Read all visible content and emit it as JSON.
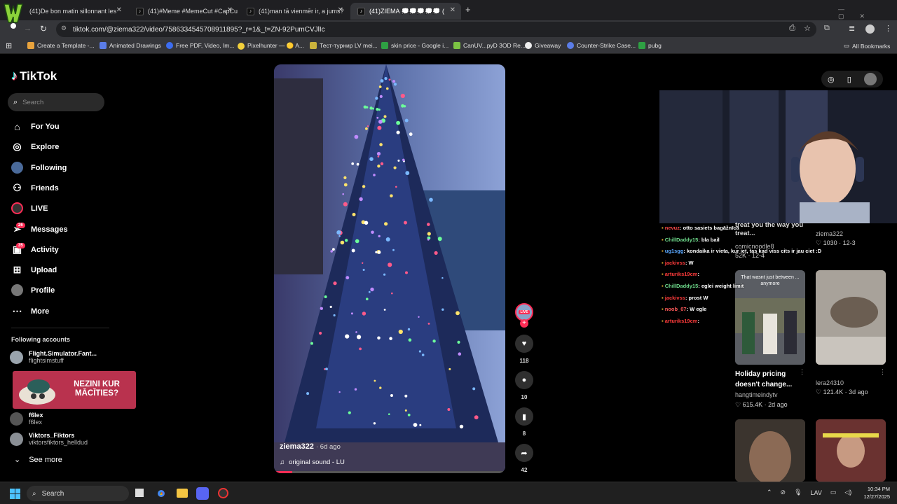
{
  "browser": {
    "tabs": [
      {
        "title": "(41)De bon matin sillonnant les"
      },
      {
        "title": "(41)#Meme #MemeCut #CapCu"
      },
      {
        "title": "(41)man tā vienmēr ir, a jums?"
      },
      {
        "title": "(41)ZIEMA 💭💭💭💭💭 ("
      }
    ],
    "new_tab": "+",
    "url": "tiktok.com/@ziema322/video/7586334545708911895?_r=1&_t=ZN-92PumCVJlIc",
    "bookmarks": [
      {
        "label": "Create a Template -...",
        "color": "#e8a33d"
      },
      {
        "label": "Animated Drawings",
        "color": "#5b7de8"
      },
      {
        "label": "Free PDF, Video, Im...",
        "color": "#3c6df0"
      },
      {
        "label": "Pixelhunter — 🟡 A...",
        "color": "#f2d03b"
      },
      {
        "label": "Тест-турнир LV mei...",
        "color": "#c9b23c"
      },
      {
        "label": "skin price - Google i...",
        "color": "#2ea043"
      },
      {
        "label": "CanUV...pyD 3OD Re...",
        "color": "#7cc243"
      },
      {
        "label": "Giveaway",
        "color": "#eeeeee"
      },
      {
        "label": "Counter-Strike Case...",
        "color": "#5b7de8"
      },
      {
        "label": "pubg",
        "color": "#2ea043"
      }
    ],
    "all_bookmarks": "All Bookmarks"
  },
  "tiktok": {
    "logo": "TikTok",
    "search_placeholder": "Search",
    "nav": [
      {
        "label": "For You",
        "icon": "home-icon"
      },
      {
        "label": "Explore",
        "icon": "compass-icon"
      },
      {
        "label": "Following",
        "icon": "following-avatar-icon"
      },
      {
        "label": "Friends",
        "icon": "friends-icon"
      },
      {
        "label": "LIVE",
        "icon": "live-icon"
      },
      {
        "label": "Messages",
        "icon": "messages-icon",
        "badge": "26"
      },
      {
        "label": "Activity",
        "icon": "activity-icon",
        "badge": "35"
      },
      {
        "label": "Upload",
        "icon": "upload-icon"
      },
      {
        "label": "Profile",
        "icon": "profile-icon"
      },
      {
        "label": "More",
        "icon": "more-icon"
      }
    ],
    "following_title": "Following accounts",
    "accounts": [
      {
        "name": "Flight.Simulator.Fant...",
        "handle": "flightsimstuff"
      },
      {
        "name": "f6lex",
        "handle": "f6lex"
      },
      {
        "name": "Viktors_Fiktors",
        "handle": "viktorsfiktors_helldud"
      }
    ],
    "see_more": "See more",
    "ad_banner": "NEZINI KUR MĀCĪTIES?",
    "video": {
      "author": "ziema322",
      "date": "· 6d ago",
      "sound": "original sound - LU",
      "live_badge": "LIVE",
      "likes": "118",
      "comments": "10",
      "saves": "8",
      "shares": "42"
    }
  },
  "recommendations": [
    {
      "title": "treat you the way you treat...",
      "author": "comicnoodle8",
      "meta": "52K · 12-4"
    },
    {
      "title": "",
      "author": "ziema322",
      "meta": "♡ 1030 · 12-3"
    },
    {
      "title": "Holiday pricing doesn't change...",
      "author": "hangtimeindytv",
      "meta": "♡ 615.4K · 2d ago",
      "overlay": "That wasnt just between ... anymore"
    },
    {
      "title": "",
      "author": "lera24310",
      "meta": "♡ 121.4K · 3d ago"
    }
  ],
  "stream_chat": [
    {
      "user": "nevuz",
      "msg": ": otto sasiets bagāžnīcā",
      "color": "#ff4a4a"
    },
    {
      "user": "ChillDaddy15",
      "msg": ": bla bail",
      "color": "#6fdc8c"
    },
    {
      "user": "ug1sgg",
      "msg": ": kondaika ir vieta, kur iet, tas kad viss cits ir jau ciet :D",
      "color": "#5aa8ff"
    },
    {
      "user": "jackivss",
      "msg": ": W",
      "color": "#ff3b3b"
    },
    {
      "user": "arturiks19cm",
      "msg": ":",
      "color": "#ff3b3b"
    },
    {
      "user": "ChillDaddy15",
      "msg": ": eglei weight limit",
      "color": "#6fdc8c"
    },
    {
      "user": "jackivss",
      "msg": ": prost W",
      "color": "#ff3b3b"
    },
    {
      "user": "noob_07",
      "msg": ": W egle",
      "color": "#ff5a5a"
    },
    {
      "user": "arturiks19cm",
      "msg": ":",
      "color": "#ff3b3b"
    }
  ],
  "taskbar": {
    "search": "Search",
    "lang": "LAV",
    "time": "10:34 PM",
    "date": "12/27/2025"
  }
}
